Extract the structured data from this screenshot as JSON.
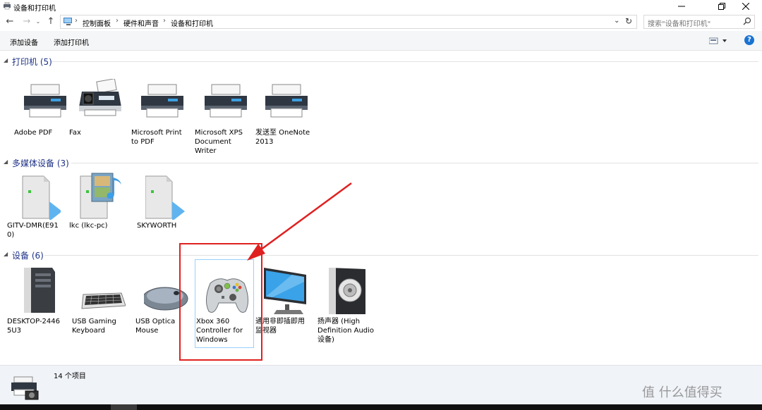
{
  "window": {
    "title": "设备和打印机"
  },
  "address_bar": {
    "breadcrumbs": [
      "控制面板",
      "硬件和声音",
      "设备和打印机"
    ],
    "search_placeholder": "搜索\"设备和打印机\""
  },
  "command_bar": {
    "add_device": "添加设备",
    "add_printer": "添加打印机",
    "help": "?"
  },
  "groups": [
    {
      "label": "打印机 (5)",
      "items": [
        {
          "label": "Adobe PDF",
          "icon": "printer-icon"
        },
        {
          "label": "Fax",
          "icon": "fax-icon"
        },
        {
          "label": "Microsoft Print\nto PDF",
          "icon": "printer-icon"
        },
        {
          "label": "Microsoft XPS\nDocument\nWriter",
          "icon": "printer-icon"
        },
        {
          "label": "发送至 OneNote\n2013",
          "icon": "printer-icon"
        }
      ]
    },
    {
      "label": "多媒体设备 (3)",
      "items": [
        {
          "label": "GITV-DMR(E91\n0)",
          "icon": "media-server-icon"
        },
        {
          "label": "lkc (lkc-pc)",
          "icon": "media-library-icon"
        },
        {
          "label": "SKYWORTH",
          "icon": "media-server-icon"
        }
      ]
    },
    {
      "label": "设备 (6)",
      "items": [
        {
          "label": "DESKTOP-2446\n5U3",
          "icon": "computer-tower-icon"
        },
        {
          "label": "USB Gaming\nKeyboard",
          "icon": "keyboard-icon"
        },
        {
          "label": "USB Optica\nMouse",
          "icon": "mouse-icon"
        },
        {
          "label": "Xbox 360\nController for\nWindows",
          "icon": "gamepad-icon"
        },
        {
          "label": "通用非即插即用\n监视器",
          "icon": "monitor-icon"
        },
        {
          "label": "扬声器 (High\nDefinition Audio\n设备)",
          "icon": "speaker-icon"
        }
      ]
    }
  ],
  "details": {
    "count": "14 个项目"
  },
  "watermark": "值 什么值得买",
  "colors": {
    "group_header": "#1e3287",
    "annotation": "#e02020",
    "selection": "#99d1ff",
    "help": "#1a73d1"
  }
}
